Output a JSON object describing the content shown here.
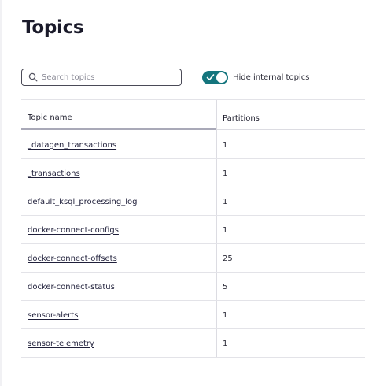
{
  "page": {
    "title": "Topics"
  },
  "search": {
    "placeholder": "Search topics",
    "value": ""
  },
  "filter": {
    "hide_internal_label": "Hide internal topics",
    "hide_internal_on": true
  },
  "table": {
    "columns": [
      "Topic name",
      "Partitions"
    ],
    "rows": [
      {
        "name": "_datagen_transactions",
        "partitions": "1"
      },
      {
        "name": "_transactions",
        "partitions": "1"
      },
      {
        "name": "default_ksql_processing_log",
        "partitions": "1"
      },
      {
        "name": "docker-connect-configs",
        "partitions": "1"
      },
      {
        "name": "docker-connect-offsets",
        "partitions": "25"
      },
      {
        "name": "docker-connect-status",
        "partitions": "5"
      },
      {
        "name": "sensor-alerts",
        "partitions": "1"
      },
      {
        "name": "sensor-telemetry",
        "partitions": "1"
      }
    ]
  },
  "colors": {
    "toggle_on": "#14757d",
    "text": "#1f1f2e"
  },
  "icons": {
    "search": "search-icon",
    "toggle_check": "check-icon"
  }
}
